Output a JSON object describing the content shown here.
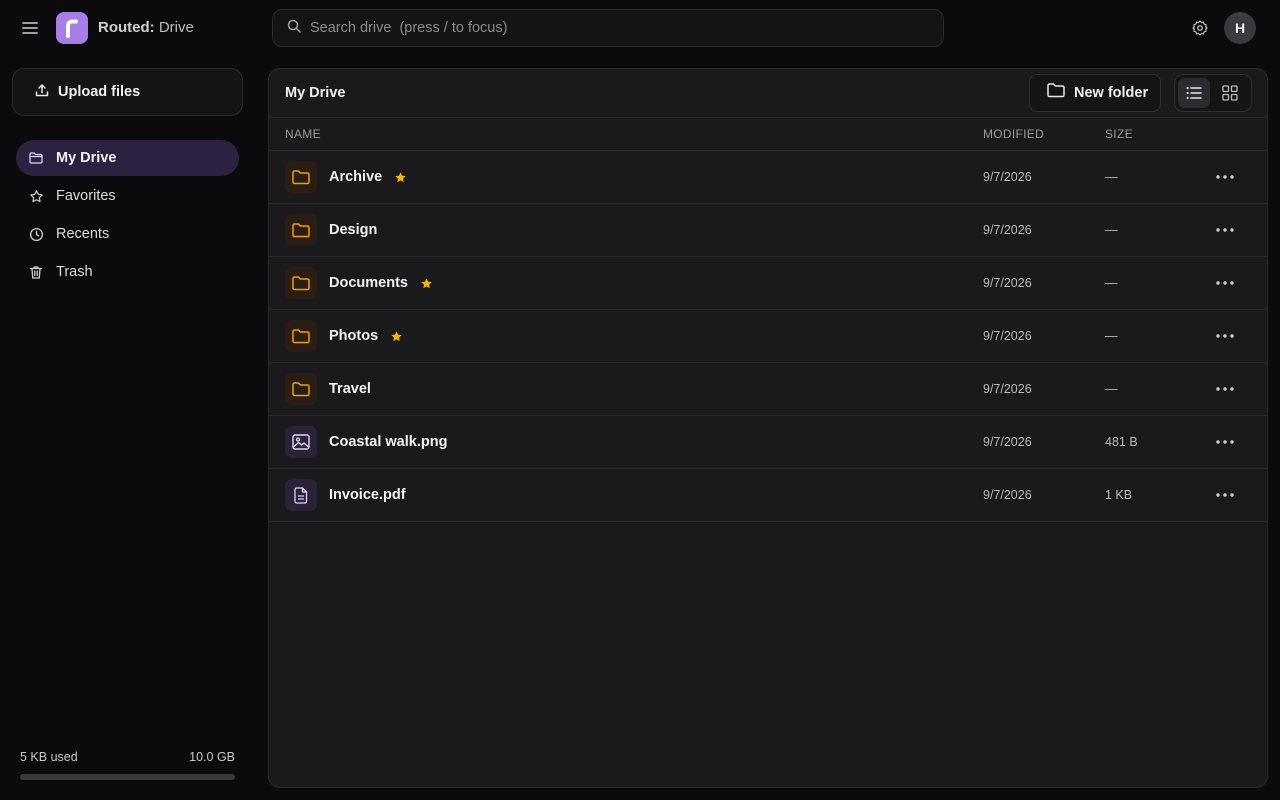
{
  "app": {
    "brand_bold": "Routed:",
    "brand_rest": " Drive",
    "logo_letter": "r"
  },
  "search": {
    "placeholder": "Search drive  (press / to focus)",
    "value": ""
  },
  "user": {
    "avatar_initial": "H"
  },
  "sidebar": {
    "upload_label": "Upload files",
    "items": [
      {
        "label": "My Drive",
        "icon": "folder-icon",
        "active": true
      },
      {
        "label": "Favorites",
        "icon": "star-icon",
        "active": false
      },
      {
        "label": "Recents",
        "icon": "clock-icon",
        "active": false
      },
      {
        "label": "Trash",
        "icon": "trash-icon",
        "active": false
      }
    ],
    "storage": {
      "used_label": "5 KB used",
      "total_label": "10.0 GB",
      "used_fraction": 5e-07
    }
  },
  "main": {
    "title": "My Drive",
    "new_folder_label": "New folder",
    "view_mode": "list",
    "columns": {
      "name": "NAME",
      "modified": "MODIFIED",
      "size": "SIZE"
    },
    "rows": [
      {
        "name": "Archive",
        "type": "folder",
        "starred": true,
        "modified": "9/7/2026",
        "size": "—"
      },
      {
        "name": "Design",
        "type": "folder",
        "starred": false,
        "modified": "9/7/2026",
        "size": "—"
      },
      {
        "name": "Documents",
        "type": "folder",
        "starred": true,
        "modified": "9/7/2026",
        "size": "—"
      },
      {
        "name": "Photos",
        "type": "folder",
        "starred": true,
        "modified": "9/7/2026",
        "size": "—"
      },
      {
        "name": "Travel",
        "type": "folder",
        "starred": false,
        "modified": "9/7/2026",
        "size": "—"
      },
      {
        "name": "Coastal walk.png",
        "type": "image",
        "starred": false,
        "modified": "9/7/2026",
        "size": "481 B"
      },
      {
        "name": "Invoice.pdf",
        "type": "document",
        "starred": false,
        "modified": "9/7/2026",
        "size": "1 KB"
      }
    ]
  },
  "colors": {
    "accent": "#a77ee6",
    "folder": "#f59e0b",
    "star": "#f5b40b",
    "active_nav_bg": "#2c2140"
  }
}
